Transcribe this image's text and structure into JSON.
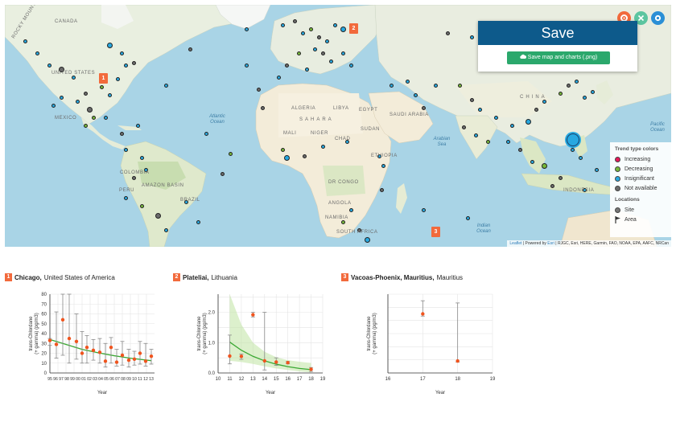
{
  "map": {
    "labels": {
      "canada": "CANADA",
      "united_states": "UNITED STATES",
      "mexico": "MEXICO",
      "colombia": "COLOMBIA",
      "peru": "PERU",
      "brazil": "BRAZIL",
      "amazon_basin": "AMAZON BASIN",
      "rocky_mountains": "ROCKY MOUNTAINS",
      "algeria": "ALGERIA",
      "libya": "LIBYA",
      "egypt": "EGYPT",
      "mali": "MALI",
      "niger": "NIGER",
      "chad": "CHAD",
      "sudan": "SUDAN",
      "sahara": "SAHARA",
      "saudi_arabia": "SAUDI ARABIA",
      "ethiopia": "ETHIOPIA",
      "dr_congo": "DR CONGO",
      "angola": "ANGOLA",
      "namibia": "NAMIBIA",
      "south_africa": "SOUTH AFRICA",
      "china": "CHINA",
      "indonesia": "INDONESIA",
      "arabian_sea": "Arabian Sea",
      "atlantic_ocean": "Atlantic Ocean",
      "indian_ocean": "Indian Ocean",
      "pacific_ocean": "Pacific Ocean"
    },
    "pins": [
      {
        "id": "1"
      },
      {
        "id": "2"
      },
      {
        "id": "3"
      }
    ],
    "attribution": {
      "leaflet": "Leaflet",
      "powered_by": " | Powered by ",
      "esri": "Esri",
      "sources": " | RJGC, Esri, HERE, Garmin, FAO, NOAA, EPA, AAFC, NRCan"
    }
  },
  "top_buttons": {
    "settings_icon": "gear-icon",
    "close_icon": "close-icon",
    "info_icon": "info-icon",
    "colors": {
      "settings": "#f26a3c",
      "close": "#5bc5a0",
      "info": "#2b8fd6"
    }
  },
  "save_panel": {
    "title": "Save",
    "button_label": "Save map and charts (.png)",
    "button_icon": "cloud-upload-icon"
  },
  "legend": {
    "trend_title": "Trend type colors",
    "trend_items": [
      {
        "label": "Increasing",
        "color": "#e8185a"
      },
      {
        "label": "Decreasing",
        "color": "#76b83a"
      },
      {
        "label": "Insignificant",
        "color": "#27a8e0"
      },
      {
        "label": "Not available",
        "color": "#6b6b6b"
      }
    ],
    "locations_title": "Locations",
    "location_items": [
      {
        "label": "Site",
        "icon": "site-dot-icon"
      },
      {
        "label": "Area",
        "icon": "flag-icon"
      }
    ]
  },
  "charts": [
    {
      "badge": "1",
      "title_bold": "Chicago,",
      "title_rest": "United States of America",
      "ylabel": "trans-Chlordane (+ gamma) (pg/m3)",
      "xlabel": "Year"
    },
    {
      "badge": "2",
      "title_bold": "Plateliai,",
      "title_rest": "Lithuania",
      "ylabel": "trans-Chlordane (+ gamma) (pg/m3)",
      "xlabel": "Year"
    },
    {
      "badge": "3",
      "title_bold": "Vacoas-Phoenix, Mauritius,",
      "title_rest": "Mauritius",
      "ylabel": "trans-Chlordane (+ gamma) (pg/m3)",
      "xlabel": "Year"
    }
  ],
  "chart_data": [
    {
      "type": "scatter",
      "title": "Chicago, United States of America",
      "xlabel": "Year",
      "ylabel": "trans-Chlordane (+ gamma) (pg/m3)",
      "xticks": [
        "95",
        "96",
        "97",
        "98",
        "99",
        "00",
        "01",
        "02",
        "03",
        "04",
        "05",
        "06",
        "07",
        "08",
        "09",
        "10",
        "11",
        "12",
        "13"
      ],
      "yticks": [
        0,
        10,
        20,
        30,
        40,
        50,
        60,
        70,
        80
      ],
      "ylim": [
        0,
        80
      ],
      "points": [
        {
          "x": 0.0,
          "y": 33,
          "lo": 28,
          "hi": 35
        },
        {
          "x": 0.8,
          "y": 29,
          "lo": 15,
          "hi": 62
        },
        {
          "x": 1.6,
          "y": 54,
          "lo": 18,
          "hi": 80
        },
        {
          "x": 2.4,
          "y": 35,
          "lo": 10,
          "hi": 80
        },
        {
          "x": 3.3,
          "y": 32,
          "lo": 14,
          "hi": 60
        },
        {
          "x": 4.0,
          "y": 20,
          "lo": 10,
          "hi": 42
        },
        {
          "x": 4.6,
          "y": 26,
          "lo": 10,
          "hi": 38
        },
        {
          "x": 5.4,
          "y": 23,
          "lo": 13,
          "hi": 34
        },
        {
          "x": 6.2,
          "y": 21,
          "lo": 10,
          "hi": 35
        },
        {
          "x": 6.9,
          "y": 12,
          "lo": 6,
          "hi": 30
        },
        {
          "x": 7.6,
          "y": 26,
          "lo": 10,
          "hi": 36
        },
        {
          "x": 8.3,
          "y": 11,
          "lo": 7,
          "hi": 24
        },
        {
          "x": 9.0,
          "y": 18,
          "lo": 8,
          "hi": 32
        },
        {
          "x": 9.8,
          "y": 13,
          "lo": 6,
          "hi": 24
        },
        {
          "x": 10.5,
          "y": 14,
          "lo": 8,
          "hi": 22
        },
        {
          "x": 11.2,
          "y": 20,
          "lo": 9,
          "hi": 32
        },
        {
          "x": 11.9,
          "y": 12,
          "lo": 7,
          "hi": 30
        },
        {
          "x": 12.6,
          "y": 17,
          "lo": 9,
          "hi": 24
        }
      ],
      "trend": [
        {
          "x": 0,
          "y": 34
        },
        {
          "x": 2,
          "y": 29
        },
        {
          "x": 4,
          "y": 24
        },
        {
          "x": 6,
          "y": 20.5
        },
        {
          "x": 8,
          "y": 17.5
        },
        {
          "x": 10,
          "y": 15
        },
        {
          "x": 12.6,
          "y": 12.5
        }
      ],
      "xlim": [
        0,
        13
      ]
    },
    {
      "type": "scatter",
      "title": "Plateliai, Lithuania",
      "xlabel": "Year",
      "ylabel": "trans-Chlordane (+ gamma) (pg/m3)",
      "xticks": [
        "10",
        "11",
        "12",
        "13",
        "14",
        "15",
        "16",
        "17",
        "18",
        "19"
      ],
      "xlim": [
        10,
        19
      ],
      "yticks": [
        0.0,
        1.0,
        2.0
      ],
      "ylim": [
        0,
        2.6
      ],
      "points": [
        {
          "x": 11,
          "y": 0.56,
          "lo": 0.3,
          "hi": 1.25
        },
        {
          "x": 12,
          "y": 0.55,
          "lo": 0.45,
          "hi": 0.62
        },
        {
          "x": 13,
          "y": 1.92,
          "lo": 1.85,
          "hi": 2.0
        },
        {
          "x": 14,
          "y": 0.4,
          "lo": 0.1,
          "hi": 2.0
        },
        {
          "x": 15,
          "y": 0.36,
          "lo": 0.25,
          "hi": 0.5
        },
        {
          "x": 16,
          "y": 0.34,
          "lo": 0.3,
          "hi": 0.38
        },
        {
          "x": 18,
          "y": 0.12,
          "lo": 0.05,
          "hi": 0.18
        }
      ],
      "trend": [
        {
          "x": 11,
          "y": 1.02
        },
        {
          "x": 12,
          "y": 0.75
        },
        {
          "x": 13,
          "y": 0.55
        },
        {
          "x": 14,
          "y": 0.4
        },
        {
          "x": 15,
          "y": 0.29
        },
        {
          "x": 16,
          "y": 0.21
        },
        {
          "x": 17,
          "y": 0.15
        },
        {
          "x": 18,
          "y": 0.11
        }
      ],
      "band_upper": [
        {
          "x": 11,
          "y": 2.6
        },
        {
          "x": 12,
          "y": 1.6
        },
        {
          "x": 13,
          "y": 1.0
        },
        {
          "x": 14,
          "y": 0.7
        },
        {
          "x": 15,
          "y": 0.52
        },
        {
          "x": 16,
          "y": 0.42
        },
        {
          "x": 17,
          "y": 0.37
        },
        {
          "x": 18,
          "y": 0.33
        }
      ],
      "band_lower": [
        {
          "x": 11,
          "y": 0.4
        },
        {
          "x": 12,
          "y": 0.36
        },
        {
          "x": 13,
          "y": 0.3
        },
        {
          "x": 14,
          "y": 0.22
        },
        {
          "x": 15,
          "y": 0.15
        },
        {
          "x": 16,
          "y": 0.1
        },
        {
          "x": 17,
          "y": 0.05
        },
        {
          "x": 18,
          "y": 0.02
        }
      ]
    },
    {
      "type": "scatter",
      "title": "Vacoas-Phoenix, Mauritius, Mauritius",
      "xlabel": "Year",
      "ylabel": "trans-Chlordane (+ gamma) (pg/m3)",
      "xticks": [
        "16",
        "17",
        "18",
        "19"
      ],
      "xlim": [
        16,
        19
      ],
      "yticks": [],
      "ylim": [
        0,
        3.6
      ],
      "points": [
        {
          "x": 17,
          "y": 2.7,
          "lo": 2.6,
          "hi": 3.3
        },
        {
          "x": 18,
          "y": 0.55,
          "lo": 0.5,
          "hi": 3.2
        }
      ]
    }
  ]
}
